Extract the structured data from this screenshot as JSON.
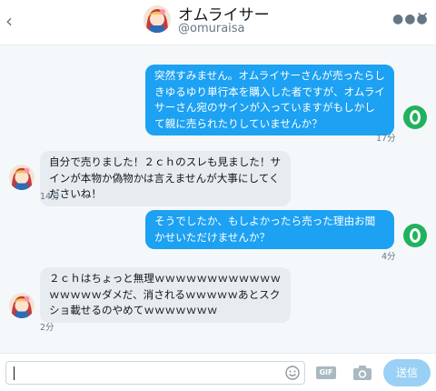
{
  "header": {
    "name": "オムライサー",
    "handle": "@omuraisa",
    "back_icon": "chevron-left-icon",
    "more_icon": "more-dots-icon",
    "close_icon": "close-icon"
  },
  "messages": [
    {
      "direction": "sent",
      "text": "突然すみません。オムライサーさんが売ったらしきゆるゆり単行本を購入した者ですが、オムライサーさん宛のサインが入っていますがもしかして親に売られたりしていませんか？",
      "time": "17分"
    },
    {
      "direction": "received",
      "text": "自分で売りました！２ｃｈのスレも見ました！サインが本物か偽物かは言えませんが大事にしてくださいね！",
      "time": "14分"
    },
    {
      "direction": "sent",
      "text": "そうでしたか、もしよかったら売った理由お聞かせいただけませんか？",
      "time": "4分"
    },
    {
      "direction": "received",
      "text": "２ｃｈはちょっと無理ｗｗｗｗｗｗｗｗｗｗｗｗｗｗｗｗｗダメだ、消されるｗｗｗｗｗあとスクショ載せるのやめてｗｗｗｗｗｗｗ",
      "time": "2分"
    }
  ],
  "composer": {
    "placeholder": "",
    "gif_label": "GIF",
    "send_label": "送信"
  },
  "colors": {
    "accent": "#1da1f2",
    "received_bubble": "#e6ecf0",
    "sender_avatar": "#20b25d"
  }
}
